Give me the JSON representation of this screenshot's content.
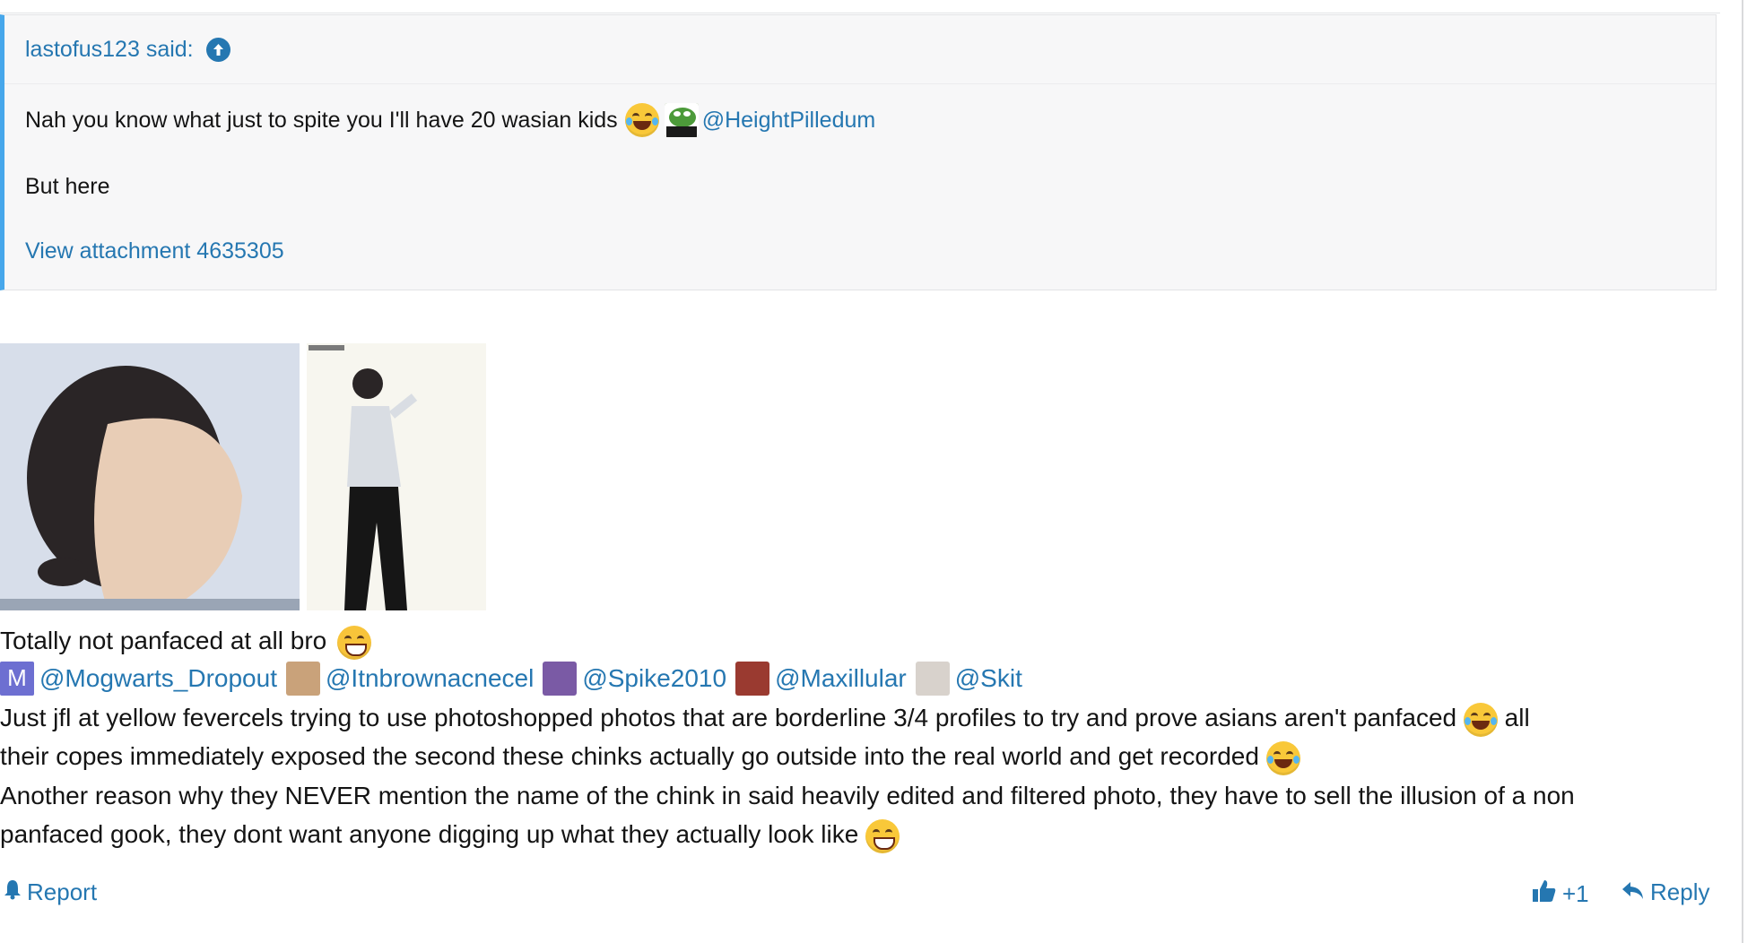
{
  "quote": {
    "author": "lastofus123 said:",
    "line1": "Nah you know what just to spite you I'll have 20 wasian kids",
    "mention": "@HeightPilledum",
    "line2": "But here",
    "attachment": "View attachment 4635305"
  },
  "post": {
    "line1": "Totally not panfaced at all bro",
    "mentions": [
      {
        "badge": "M",
        "name": "@Mogwarts_Dropout"
      },
      {
        "name": "@Itnbrownacnecel"
      },
      {
        "name": "@Spike2010"
      },
      {
        "name": "@Maxillular"
      },
      {
        "name": "@Skit"
      }
    ],
    "para1_a": "Just jfl at yellow fevercels trying to use photoshopped photos that are borderline 3/4 profiles to try and prove asians aren't panfaced",
    "para1_b": "all",
    "para1_c": "their copes immediately exposed the second these chinks actually go outside into the real world and get recorded",
    "para2_a": "Another reason why they NEVER mention the name of the chink in said heavily edited and filtered photo, they have to sell the illusion of a non",
    "para2_b": "panfaced gook, they dont want anyone digging up what they actually look like"
  },
  "actions": {
    "report": "Report",
    "reaction": "+1",
    "reply": "Reply"
  },
  "colors": {
    "link": "#2577b1",
    "quote_border": "#47a7eb"
  },
  "icons": [
    "up-arrow-icon",
    "joy-emoji-icon",
    "grin-emoji-icon",
    "bell-icon",
    "thumbs-up-icon",
    "reply-icon"
  ]
}
